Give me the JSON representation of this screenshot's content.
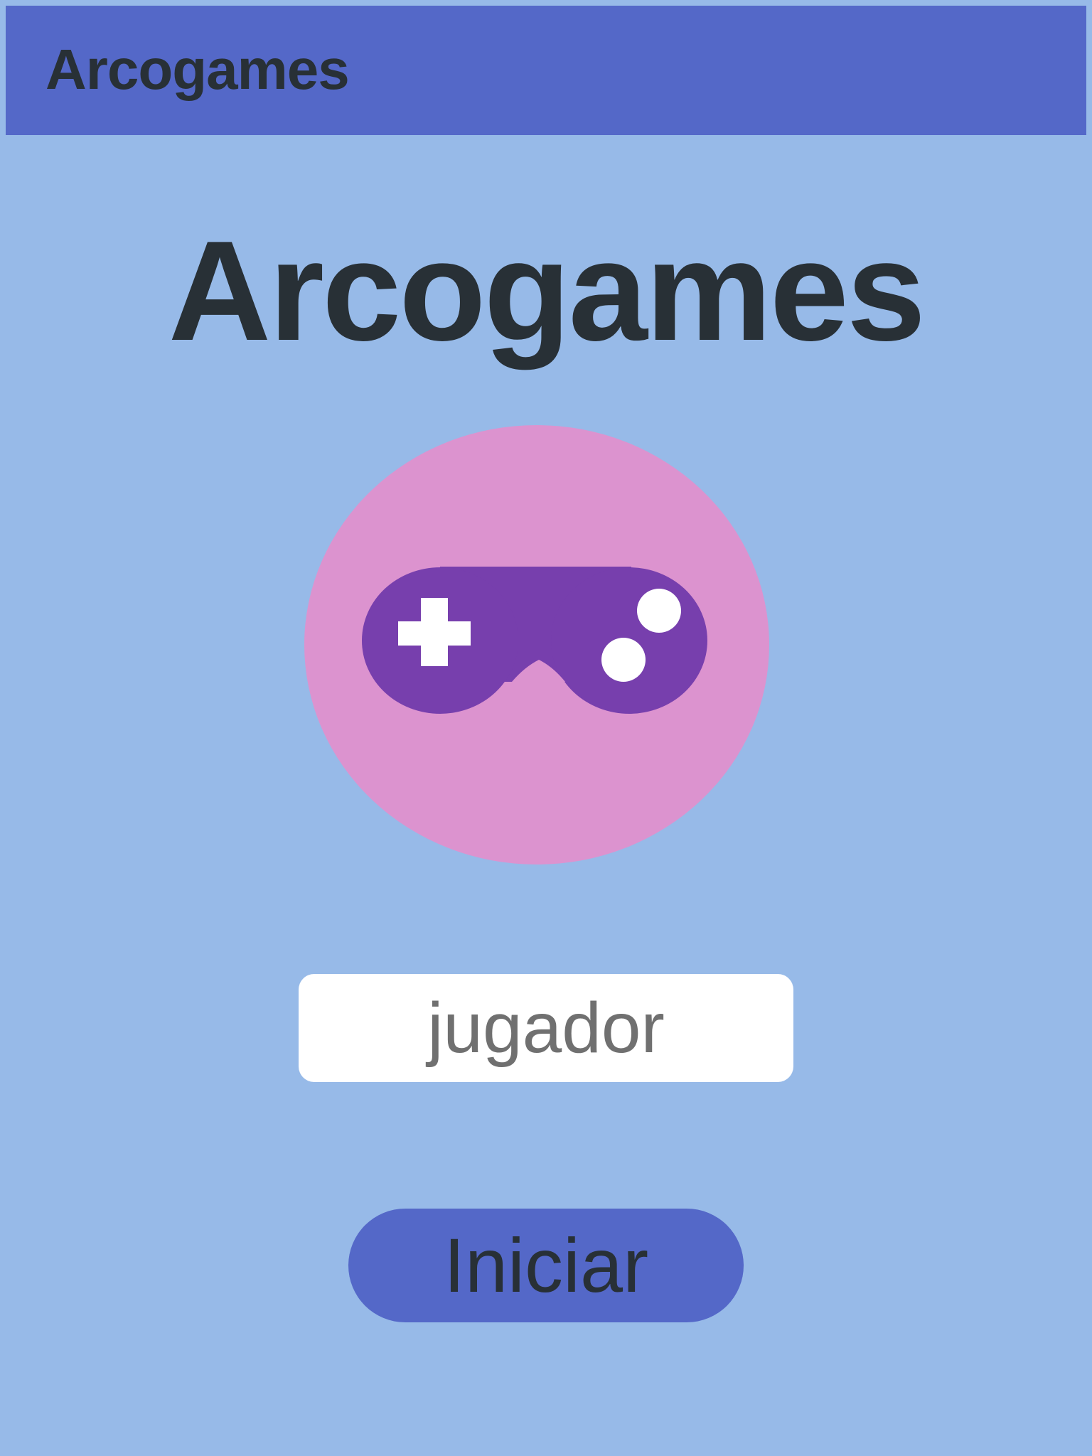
{
  "app_bar": {
    "title": "Arcogames"
  },
  "main": {
    "title": "Arcogames",
    "logo_icon": "gamepad-icon",
    "player_input": {
      "value": "",
      "placeholder": "jugador"
    },
    "start_button_label": "Iniciar"
  },
  "colors": {
    "background": "#97bae8",
    "app_bar": "#5468c8",
    "text_dark": "#283036",
    "logo_circle": "#dc93cf",
    "gamepad": "#773fad",
    "input_bg": "#ffffff",
    "placeholder": "#707070",
    "button": "#5468c8"
  }
}
